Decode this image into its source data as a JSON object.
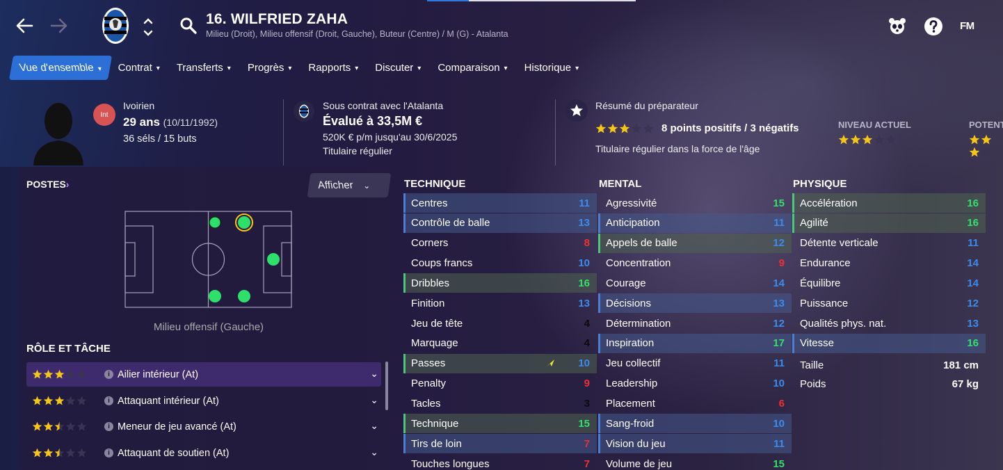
{
  "header": {
    "player_title": "16. WILFRIED ZAHA",
    "player_positions": "Milieu (Droit), Milieu offensif (Droit, Gauche), Buteur (Centre) / M (G) - Atalanta",
    "fm_logo": "FM",
    "icons": [
      "back-arrow-icon",
      "forward-arrow-icon",
      "club-crest-icon",
      "up-down-chevron-icon",
      "search-icon",
      "panda-icon",
      "help-icon"
    ]
  },
  "tabs": [
    {
      "label": "Vue d'ensemble",
      "active": true
    },
    {
      "label": "Contrat"
    },
    {
      "label": "Transferts"
    },
    {
      "label": "Progrès"
    },
    {
      "label": "Rapports"
    },
    {
      "label": "Discuter"
    },
    {
      "label": "Comparaison"
    },
    {
      "label": "Historique"
    }
  ],
  "info": {
    "badge": "Int",
    "nationality": "Ivoirien",
    "age": "29 ans",
    "dob": "(10/11/1992)",
    "caps": "36 séls / 15 buts",
    "contract_head": "Sous contrat avec l'Atalanta",
    "value": "Évalué à 33,5M €",
    "wage": "520K € p/m jusqu'au 30/6/2025",
    "status": "Titulaire régulier",
    "coach_head": "Résumé du préparateur",
    "coach_summary": "8 points positifs / 3 négatifs",
    "coach_stars": 3,
    "coach_desc": "Titulaire régulier dans la force de l'âge",
    "level_label": "NIVEAU ACTUEL",
    "level_stars": 3,
    "potential_label": "POTENT",
    "potential_stars": 3
  },
  "positions": {
    "title": "POSTES",
    "filter_label": "Afficher",
    "caption": "Milieu offensif (Gauche)"
  },
  "roles": {
    "title": "RÔLE ET TÂCHE",
    "items": [
      {
        "label": "Ailier intérieur (At)",
        "stars": 3
      },
      {
        "label": "Attaquant intérieur (At)",
        "stars": 3
      },
      {
        "label": "Meneur de jeu avancé (At)",
        "stars": 2.5
      },
      {
        "label": "Attaquant de soutien (At)",
        "stars": 2.5
      }
    ]
  },
  "attributes": {
    "technique": {
      "title": "TECHNIQUE",
      "items": [
        {
          "name": "Centres",
          "value": "11",
          "color": "blue",
          "hl": "blue"
        },
        {
          "name": "Contrôle de balle",
          "value": "13",
          "color": "blue",
          "hl": "blue"
        },
        {
          "name": "Corners",
          "value": "8",
          "color": "red",
          "hl": ""
        },
        {
          "name": "Coups francs",
          "value": "10",
          "color": "blue",
          "hl": ""
        },
        {
          "name": "Dribbles",
          "value": "16",
          "color": "green",
          "hl": "green"
        },
        {
          "name": "Finition",
          "value": "13",
          "color": "blue",
          "hl": ""
        },
        {
          "name": "Jeu de tête",
          "value": "4",
          "color": "dark",
          "hl": ""
        },
        {
          "name": "Marquage",
          "value": "4",
          "color": "dark",
          "hl": ""
        },
        {
          "name": "Passes",
          "value": "10",
          "color": "blue",
          "hl": "green"
        },
        {
          "name": "Penalty",
          "value": "9",
          "color": "red",
          "hl": ""
        },
        {
          "name": "Tacles",
          "value": "3",
          "color": "dark",
          "hl": ""
        },
        {
          "name": "Technique",
          "value": "15",
          "color": "green",
          "hl": "green"
        },
        {
          "name": "Tirs de loin",
          "value": "7",
          "color": "red",
          "hl": "blue"
        },
        {
          "name": "Touches longues",
          "value": "7",
          "color": "red",
          "hl": ""
        }
      ]
    },
    "mental": {
      "title": "MENTAL",
      "items": [
        {
          "name": "Agressivité",
          "value": "15",
          "color": "green",
          "hl": ""
        },
        {
          "name": "Anticipation",
          "value": "11",
          "color": "blue",
          "hl": "blue"
        },
        {
          "name": "Appels de balle",
          "value": "12",
          "color": "blue",
          "hl": "green"
        },
        {
          "name": "Concentration",
          "value": "9",
          "color": "red",
          "hl": ""
        },
        {
          "name": "Courage",
          "value": "14",
          "color": "blue",
          "hl": ""
        },
        {
          "name": "Décisions",
          "value": "13",
          "color": "blue",
          "hl": "blue"
        },
        {
          "name": "Détermination",
          "value": "12",
          "color": "blue",
          "hl": ""
        },
        {
          "name": "Inspiration",
          "value": "17",
          "color": "green",
          "hl": "blue"
        },
        {
          "name": "Jeu collectif",
          "value": "11",
          "color": "blue",
          "hl": ""
        },
        {
          "name": "Leadership",
          "value": "10",
          "color": "blue",
          "hl": ""
        },
        {
          "name": "Placement",
          "value": "6",
          "color": "red",
          "hl": ""
        },
        {
          "name": "Sang-froid",
          "value": "10",
          "color": "blue",
          "hl": "blue"
        },
        {
          "name": "Vision du jeu",
          "value": "11",
          "color": "blue",
          "hl": "blue"
        },
        {
          "name": "Volume de jeu",
          "value": "15",
          "color": "green",
          "hl": ""
        }
      ]
    },
    "physique": {
      "title": "PHYSIQUE",
      "items": [
        {
          "name": "Accélération",
          "value": "16",
          "color": "green",
          "hl": "green"
        },
        {
          "name": "Agilité",
          "value": "16",
          "color": "green",
          "hl": "green"
        },
        {
          "name": "Détente verticale",
          "value": "11",
          "color": "blue",
          "hl": ""
        },
        {
          "name": "Endurance",
          "value": "14",
          "color": "blue",
          "hl": ""
        },
        {
          "name": "Équilibre",
          "value": "14",
          "color": "blue",
          "hl": ""
        },
        {
          "name": "Puissance",
          "value": "12",
          "color": "blue",
          "hl": ""
        },
        {
          "name": "Qualités phys. nat.",
          "value": "13",
          "color": "blue",
          "hl": ""
        },
        {
          "name": "Vitesse",
          "value": "16",
          "color": "green",
          "hl": "blue"
        }
      ],
      "height_label": "Taille",
      "height": "181 cm",
      "weight_label": "Poids",
      "weight": "67 kg"
    }
  },
  "colors": {
    "accent": "#2c6fd6",
    "green": "#33e06a",
    "blue": "#3a8cf0",
    "red": "#f03030",
    "star": "#f5c518"
  }
}
